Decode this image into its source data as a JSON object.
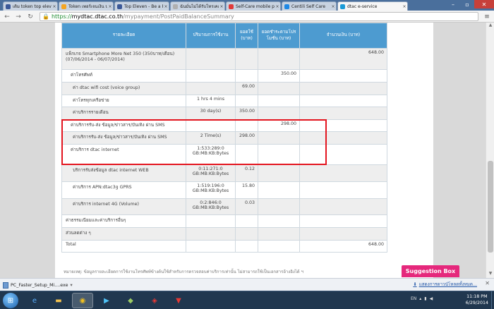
{
  "browser": {
    "tabs": [
      {
        "title": "เติม token top eleve",
        "color": "#3b5998"
      },
      {
        "title": "Token เพอร์เจนเงิน บ",
        "color": "#f5a623"
      },
      {
        "title": "Top Eleven - Be a Fo",
        "color": "#3b5998"
      },
      {
        "title": "ฉันมั่นไม่ได้รับโทรเคอ",
        "color": "#b0b0b0"
      },
      {
        "title": "Self-Care mobile po",
        "color": "#e03a3a"
      },
      {
        "title": "Centili Self Care",
        "color": "#1e88e5"
      },
      {
        "title": "dtac e-service",
        "color": "#1b9bd7"
      }
    ],
    "url_scheme": "https://",
    "url_host": "mydtac.dtac.co.th",
    "url_path": "/mypayment/PostPaidBalanceSummary"
  },
  "table": {
    "headers": [
      "รายละเอียด",
      "ปริมาณการใช้งาน",
      "ยอดใช้ (บาท)",
      "ยอดชำระตามโปรโมชั่น (บาท)",
      "จำนวนเงิน (บาท)"
    ],
    "rows": [
      {
        "label": "แพ็กเกจ Smartphone More Net 350 (350บาท/เดือน) (07/06/2014 - 06/07/2014)",
        "usage": "",
        "used": "",
        "promo": "",
        "amount": "648.00",
        "indent": 1,
        "shade": true
      },
      {
        "label": "ค่าโทรศัพท์",
        "usage": "",
        "used": "",
        "promo": "350.00",
        "amount": "",
        "indent": 2,
        "shade": false
      },
      {
        "label": "ค่า dtac wifi cost (voice group)",
        "usage": "",
        "used": "69.00",
        "promo": "",
        "amount": "",
        "indent": 3,
        "shade": true
      },
      {
        "label": "ค่าโทรทุกเครือข่าย",
        "usage": "1 hrs 4 mins",
        "used": "",
        "promo": "",
        "amount": "",
        "indent": 3,
        "shade": false
      },
      {
        "label": "ค่าบริการรายเดือน",
        "usage": "30 day(s)",
        "used": "350.00",
        "promo": "",
        "amount": "",
        "indent": 3,
        "shade": true
      },
      {
        "label": "ค่าบริการรับ-ส่ง ข้อมูล/ข่าวสาร/บันเทิง ผ่าน SMS",
        "usage": "",
        "used": "",
        "promo": "298.00",
        "amount": "",
        "indent": 2,
        "shade": false
      },
      {
        "label": "ค่าบริการรับ-ส่ง ข้อมูล/ข่าวสาร/บันเทิง ผ่าน SMS",
        "usage": "2 Time(s)",
        "used": "298.00",
        "promo": "",
        "amount": "",
        "indent": 3,
        "shade": true
      },
      {
        "label": "ค่าบริการ dtac internet",
        "usage": "1:533:289:0 GB:MB:KB:Bytes",
        "used": "",
        "promo": "",
        "amount": "",
        "indent": 2,
        "shade": false
      },
      {
        "label": "บริการรับส่งข้อมูล dtac internet WEB",
        "usage": "0:11:271:0 GB:MB:KB:Bytes",
        "used": "0.12",
        "promo": "",
        "amount": "",
        "indent": 3,
        "shade": true
      },
      {
        "label": "ค่าบริการ APN:dtac3g GPRS",
        "usage": "1:519:196:0 GB:MB:KB:Bytes",
        "used": "15.80",
        "promo": "",
        "amount": "",
        "indent": 3,
        "shade": false
      },
      {
        "label": "ค่าบริการ internet 4G (Volume)",
        "usage": "0:2:846:0 GB:MB:KB:Bytes",
        "used": "0.03",
        "promo": "",
        "amount": "",
        "indent": 3,
        "shade": true
      },
      {
        "label": "ค่าธรรมเนียมและค่าบริการอื่นๆ",
        "usage": "",
        "used": "",
        "promo": "",
        "amount": "",
        "indent": 1,
        "shade": false
      },
      {
        "label": "ส่วนลดต่าง ๆ",
        "usage": "",
        "used": "",
        "promo": "",
        "amount": "",
        "indent": 1,
        "shade": true
      },
      {
        "label": "Total",
        "usage": "",
        "used": "",
        "promo": "",
        "amount": "648.00",
        "indent": 1,
        "shade": false
      }
    ]
  },
  "footnote": "หมายเหตุ: ข้อมูลรายละเอียดการใช้งานโทรศัพท์ข้างต้นใช้สำหรับการตรวจสอบค่าบริการเท่านั้น ไม่สามารถใช้เป็นเอกสารอ้างอิงได้ ฯ",
  "suggestion_box": "Suggestion Box",
  "download": {
    "filename": "PC_Faster_Setup_Mi....exe",
    "show_all": "แสดงการดาวน์โหลดทั้งหมด..."
  },
  "taskbar": {
    "time": "11:18 PM",
    "date": "6/29/2014",
    "lang": "EN"
  },
  "colors": {
    "header_blue": "#4d9bd0",
    "highlight_red": "#e3151f",
    "suggestion_pink": "#e5287c"
  }
}
